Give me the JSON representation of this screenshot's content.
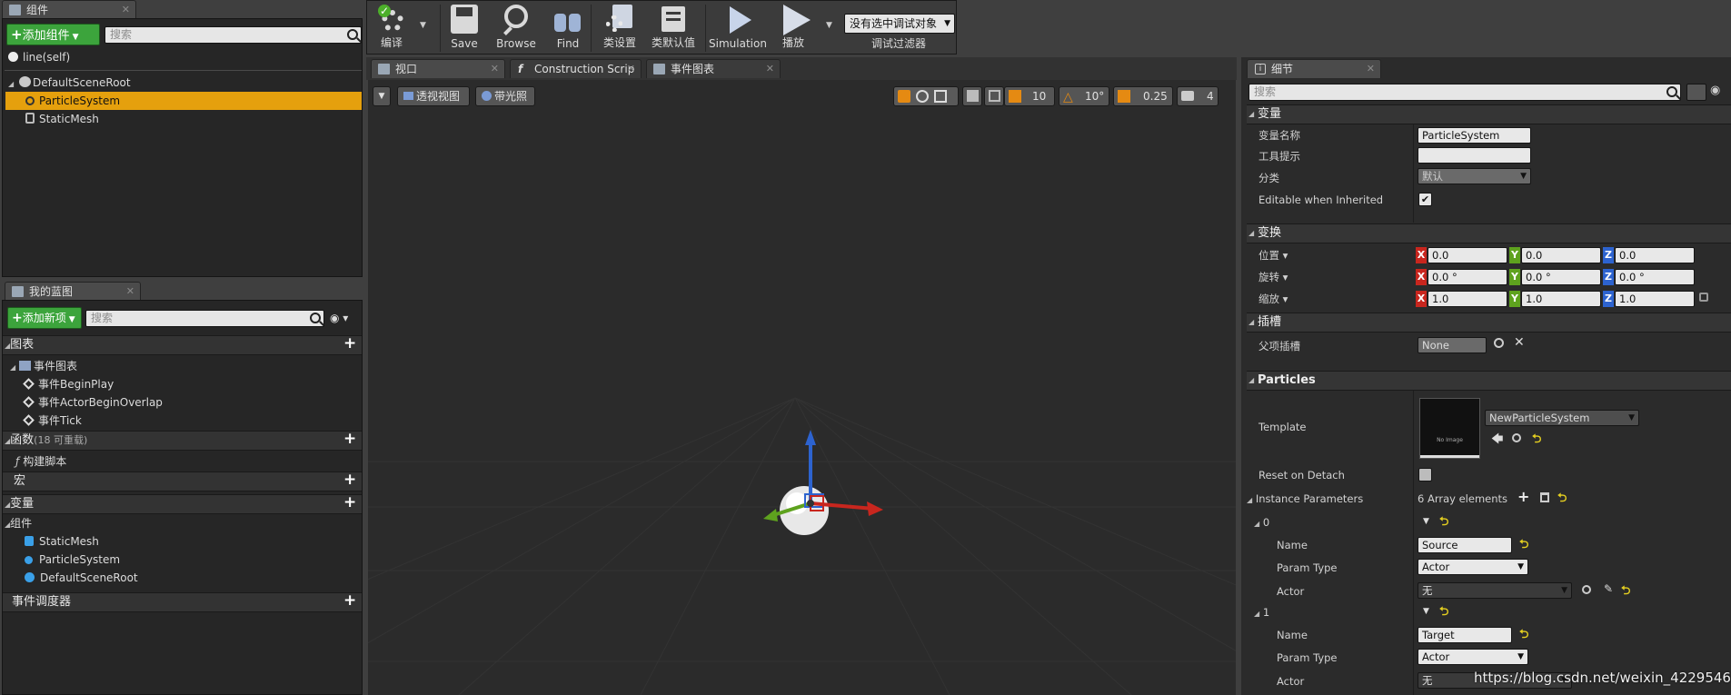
{
  "components_panel": {
    "tab_label": "组件",
    "add_button": "添加组件",
    "search_placeholder": "搜索",
    "self_item": "line(self)",
    "tree": [
      "DefaultSceneRoot",
      "ParticleSystem",
      "StaticMesh"
    ]
  },
  "blueprint_panel": {
    "tab_label": "我的蓝图",
    "add_button": "添加新项",
    "search_placeholder": "搜索",
    "graphs_header": "图表",
    "event_graph": "事件图表",
    "events": [
      "事件BeginPlay",
      "事件ActorBeginOverlap",
      "事件Tick"
    ],
    "functions_header": "函数",
    "functions_count": "(18 可重载)",
    "construction_script": "构建脚本",
    "macros_header": "宏",
    "variables_header": "变量",
    "components_header": "组件",
    "component_vars": [
      "StaticMesh",
      "ParticleSystem",
      "DefaultSceneRoot"
    ],
    "dispatchers_header": "事件调度器"
  },
  "toolbar": {
    "compile": "编译",
    "save": "Save",
    "browse": "Browse",
    "find": "Find",
    "class_settings": "类设置",
    "class_defaults": "类默认值",
    "simulation": "Simulation",
    "play": "播放",
    "debug_object": "没有选中调试对象",
    "debug_filter": "调试过滤器"
  },
  "editor_tabs": [
    "视口",
    "Construction Scrip",
    "事件图表"
  ],
  "viewport": {
    "perspective": "透视视图",
    "lit": "带光照",
    "grid_snap": "10",
    "rotation_snap": "10°",
    "scale_snap": "0.25",
    "camera_speed": "4"
  },
  "details": {
    "tab_label": "细节",
    "search_placeholder": "搜索",
    "variable_section": "变量",
    "variable_name_label": "变量名称",
    "variable_name": "ParticleSystem",
    "tooltip_label": "工具提示",
    "tooltip_value": "",
    "category_label": "分类",
    "category_value": "默认",
    "editable_label": "Editable when Inherited",
    "editable_checked": true,
    "transform_section": "变换",
    "location_label": "位置",
    "rotation_label": "旋转",
    "scale_label": "缩放",
    "location": [
      "0.0",
      "0.0",
      "0.0"
    ],
    "rotation": [
      "0.0 °",
      "0.0 °",
      "0.0 °"
    ],
    "scale": [
      "1.0",
      "1.0",
      "1.0"
    ],
    "sockets_section": "插槽",
    "parent_socket_label": "父项插槽",
    "parent_socket_value": "None",
    "particles_section": "Particles",
    "template_label": "Template",
    "template_value": "NewParticleSystem",
    "thumb_text": "No Image",
    "reset_on_detach_label": "Reset on Detach",
    "instance_params_label": "Instance Parameters",
    "array_count": "6 Array elements",
    "elements": [
      {
        "index": "0",
        "name_label": "Name",
        "name": "Source",
        "param_type_label": "Param Type",
        "param_type": "Actor",
        "actor_label": "Actor",
        "actor": "无"
      },
      {
        "index": "1",
        "name_label": "Name",
        "name": "Target",
        "param_type_label": "Param Type",
        "param_type": "Actor",
        "actor_label": "Actor",
        "actor": "无"
      }
    ]
  },
  "watermark": "https://blog.csdn.net/weixin_42295465",
  "colors": {
    "accent_green": "#3ca43c",
    "selection_orange": "#e5a00d",
    "x_axis": "#c8261e",
    "y_axis": "#5ea21e",
    "z_axis": "#2d63cf"
  }
}
